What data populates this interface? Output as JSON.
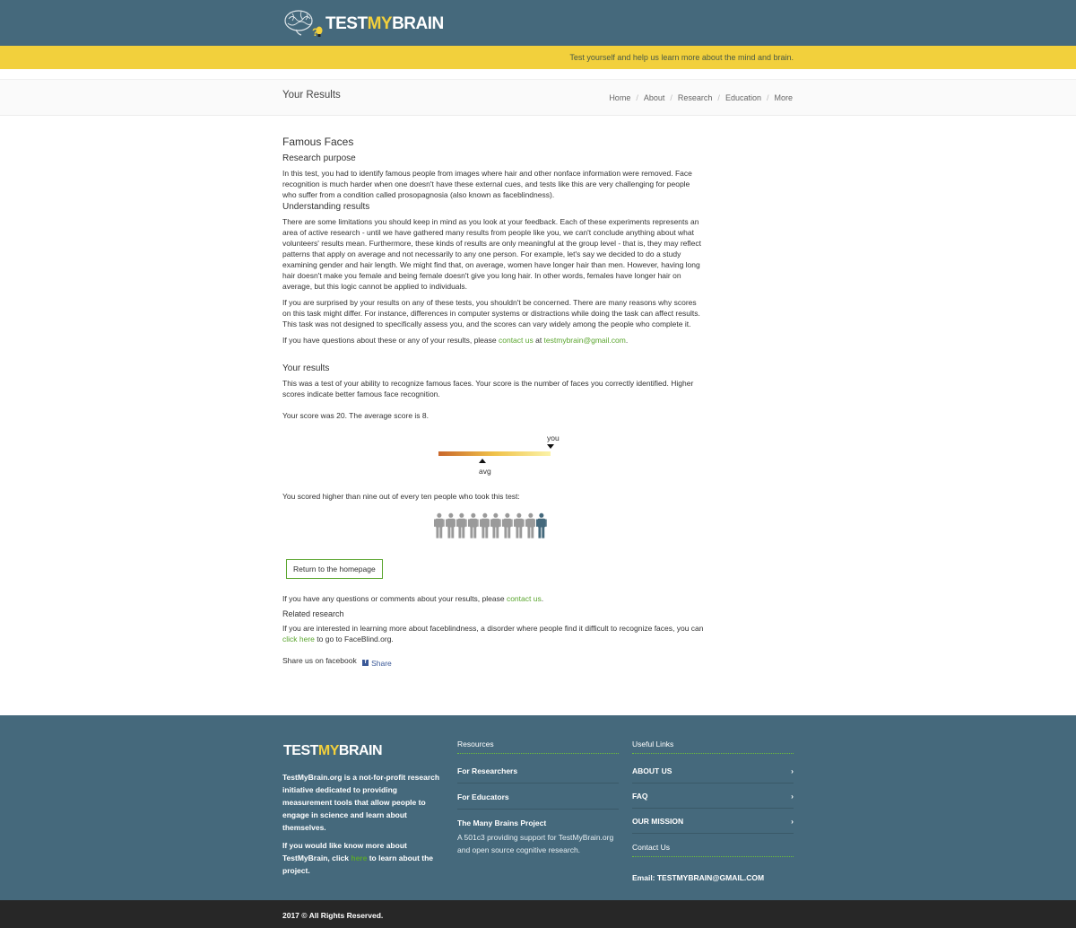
{
  "header": {
    "logo_test": "TEST",
    "logo_my": "MY",
    "logo_brain": "BRAIN",
    "tagline": "Test yourself and help us learn more about the mind and brain."
  },
  "title_strip": {
    "title": "Your Results",
    "breadcrumb": [
      "Home",
      "About",
      "Research",
      "Education",
      "More"
    ],
    "separator": "/"
  },
  "main": {
    "test_name": "Famous Faces",
    "purpose_heading": "Research purpose",
    "purpose_text": "In this test, you had to identify famous people from images where hair and other nonface information were removed. Face recognition is much harder when one doesn't have these external cues, and tests like this are very challenging for people who suffer from a condition called prosopagnosia (also known as faceblindness).",
    "understanding_heading": "Understanding results",
    "understanding_text_1": "There are some limitations you should keep in mind as you look at your feedback. Each of these experiments represents an area of active research - until we have gathered many results from people like you, we can't conclude anything about what volunteers' results mean. Furthermore, these kinds of results are only meaningful at the group level - that is, they may reflect patterns that apply on average and not necessarily to any one person. For example, let's say we decided to do a study examining gender and hair length. We might find that, on average, women have longer hair than men. However, having long hair doesn't make you female and being female doesn't give you long hair. In other words, females have longer hair on average, but this logic cannot be applied to individuals.",
    "understanding_text_2": "If you are surprised by your results on any of these tests, you shouldn't be concerned. There are many reasons why scores on this task might differ. For instance, differences in computer systems or distractions while doing the task can affect results. This task was not designed to specifically assess you, and the scores can vary widely among the people who complete it.",
    "questions_prefix": "If you have questions about these or any of your results, please ",
    "contact_link": "contact us",
    "questions_mid": " at ",
    "email_link": "testmybrain@gmail.com",
    "questions_suffix": ".",
    "results_heading": "Your results",
    "results_text": "This was a test of your ability to recognize famous faces. Your score is the number of faces you correctly identified. Higher scores indicate better famous face recognition.",
    "score_text": "Your score was 20. The average score is 8.",
    "you_label": "you",
    "avg_label": "avg",
    "you_position": 1.0,
    "avg_position": 0.4,
    "comparison_text": "You scored higher than nine out of every ten people who took this test:",
    "people_total": 10,
    "people_highlighted_index": 9,
    "colors": {
      "person_gray": "#9a9a9a",
      "person_you": "#45697c"
    },
    "home_button": "Return to the homepage",
    "comments_prefix": "If you have any questions or comments about your results, please ",
    "comments_link": "contact us",
    "comments_suffix": ".",
    "related_heading": "Related research",
    "related_prefix": "If you are interested in learning more about faceblindness, a disorder where people find it difficult to recognize faces, you can ",
    "related_link": "click here",
    "related_suffix": " to go to FaceBlind.org.",
    "share_label": "Share us on facebook",
    "fb_icon": "f",
    "share_button": "Share"
  },
  "footer": {
    "logo_test": "TEST",
    "logo_my": "MY",
    "logo_brain": "BRAIN",
    "about_text": "TestMyBrain.org is a not-for-profit research initiative dedicated to providing measurement tools that allow people to engage in science and learn about themselves.",
    "more_prefix": "If you would like know more about TestMyBrain, click ",
    "more_link": "here",
    "more_suffix": " to learn about the project.",
    "resources_heading": "Resources",
    "resources": [
      "For Researchers",
      "For Educators"
    ],
    "many_brains_title": "The Many Brains Project",
    "many_brains_desc": "A 501c3 providing support for TestMyBrain.org and open source cognitive research.",
    "useful_heading": "Useful Links",
    "useful_links": [
      "ABOUT US",
      "FAQ",
      "OUR MISSION"
    ],
    "chevron": "›",
    "contact_heading": "Contact Us",
    "email": "Email: TESTMYBRAIN@GMAIL.COM"
  },
  "copyright": "2017 © All Rights Reserved."
}
